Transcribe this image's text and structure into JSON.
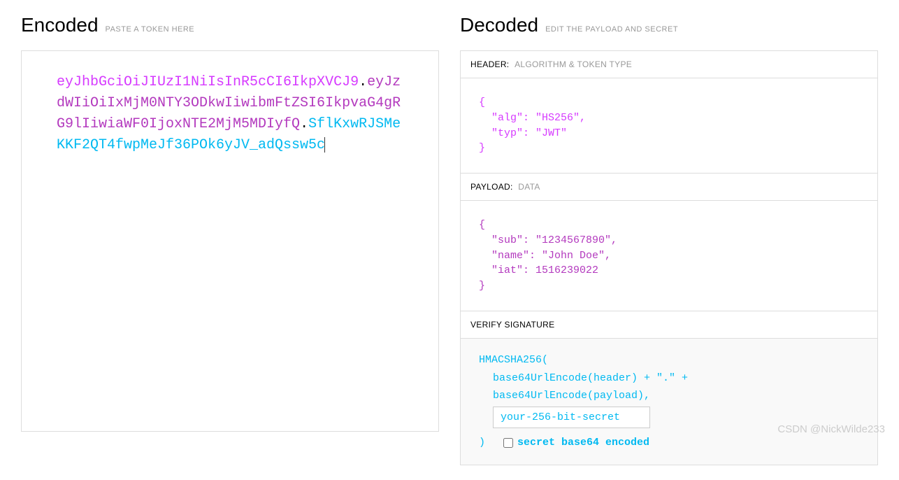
{
  "encoded": {
    "title": "Encoded",
    "subtitle": "PASTE A TOKEN HERE",
    "header": "eyJhbGciOiJIUzI1NiIsInR5cCI6IkpXVCJ9",
    "payload": "eyJzdWIiOiIxMjM0NTY3ODkwIiwibmFtZSI6IkpvaG4gRG9lIiwiaWF0IjoxNTE2MjM5MDIyfQ",
    "signature": "SflKxwRJSMeKKF2QT4fwpMeJf36POk6yJV_adQssw5c"
  },
  "decoded": {
    "title": "Decoded",
    "subtitle": "EDIT THE PAYLOAD AND SECRET",
    "header_section": {
      "label": "HEADER:",
      "desc": "ALGORITHM & TOKEN TYPE",
      "content": "{\n  \"alg\": \"HS256\",\n  \"typ\": \"JWT\"\n}"
    },
    "payload_section": {
      "label": "PAYLOAD:",
      "desc": "DATA",
      "content": "{\n  \"sub\": \"1234567890\",\n  \"name\": \"John Doe\",\n  \"iat\": 1516239022\n}"
    },
    "signature_section": {
      "label": "VERIFY SIGNATURE",
      "func": "HMACSHA256(",
      "line1": "base64UrlEncode(header) + \".\" +",
      "line2": "base64UrlEncode(payload),",
      "secret_value": "your-256-bit-secret",
      "close": ")",
      "checkbox_label": "secret base64 encoded"
    }
  },
  "watermark": "CSDN @NickWilde233"
}
